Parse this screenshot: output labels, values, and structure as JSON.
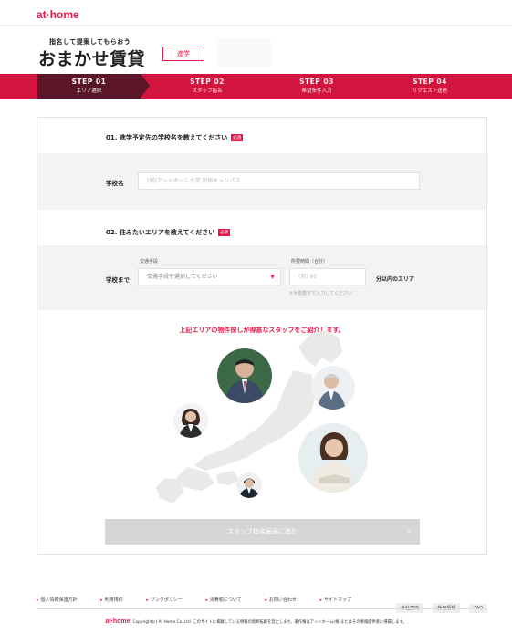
{
  "header": {
    "logo": "at·home"
  },
  "brand": {
    "subtitle": "指名して提案してもらおう",
    "title": "おまかせ賃貸",
    "badge": "進学"
  },
  "steps": [
    {
      "num": "STEP 01",
      "label": "エリア選択",
      "active": true
    },
    {
      "num": "STEP 02",
      "label": "スタッフ指名",
      "active": false
    },
    {
      "num": "STEP 03",
      "label": "希望条件入力",
      "active": false
    },
    {
      "num": "STEP 04",
      "label": "リクエスト送信",
      "active": false
    }
  ],
  "section1": {
    "title": "01. 進学予定先の学校名を教えてください",
    "required": "必須",
    "school_label": "学校名",
    "school_placeholder": "(例)アットホーム大学 新宿キャンパス"
  },
  "section2": {
    "title": "02. 住みたいエリアを教えてください",
    "required": "必須",
    "row_label": "学校まで",
    "transport_caption": "交通手段",
    "transport_placeholder": "交通手段を選択してください",
    "time_caption": "所要時間（合計）",
    "time_placeholder": "(例) 60",
    "time_suffix": "分以内のエリア",
    "time_note": "※半角数字で入力してください"
  },
  "promo": {
    "text": "上記エリアの物件探しが得意なスタッフをご紹介します。",
    "cta": "スタッフ指名画面に進む",
    "cta_arrow": "›"
  },
  "footer": {
    "links": [
      "個人情報保護方針",
      "利用規約",
      "リンクポリシー",
      "消費税について",
      "お問い合わせ",
      "サイトマップ"
    ],
    "buttons": [
      "会社案内",
      "採用情報",
      "FAQ"
    ],
    "copy_logo": "at·home",
    "copyright": "Copyright(c) At Home Co.,Ltd. このサイトに掲載している情報の無断転載を禁止します。著作権はアットホーム(株)またはその情報提供者に帰属します。"
  },
  "colors": {
    "accent": "#e8194a",
    "step_bar": "#d2143e",
    "step_active": "#5a1628"
  }
}
